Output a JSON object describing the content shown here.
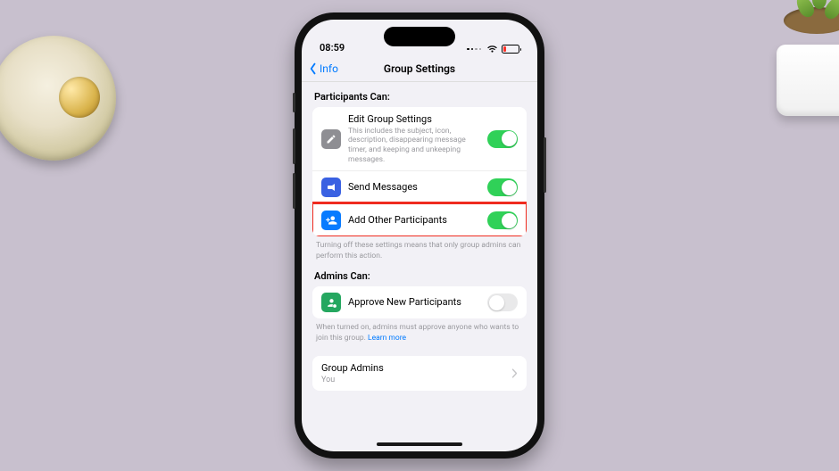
{
  "status": {
    "time": "08:59"
  },
  "nav": {
    "back_label": "Info",
    "title": "Group Settings"
  },
  "participants_section": {
    "header": "Participants Can:",
    "items": {
      "edit": {
        "title": "Edit Group Settings",
        "desc": "This includes the subject, icon, description, disappearing message timer, and keeping and unkeeping messages.",
        "enabled": true
      },
      "send": {
        "title": "Send Messages",
        "enabled": true
      },
      "add": {
        "title": "Add Other Participants",
        "enabled": true
      }
    },
    "footer": "Turning off these settings means that only group admins can perform this action."
  },
  "admins_section": {
    "header": "Admins Can:",
    "items": {
      "approve": {
        "title": "Approve New Participants",
        "enabled": false
      }
    },
    "footer": "When turned on, admins must approve anyone who wants to join this group.",
    "learn_more": "Learn more"
  },
  "group_admins": {
    "title": "Group Admins",
    "sub": "You"
  }
}
